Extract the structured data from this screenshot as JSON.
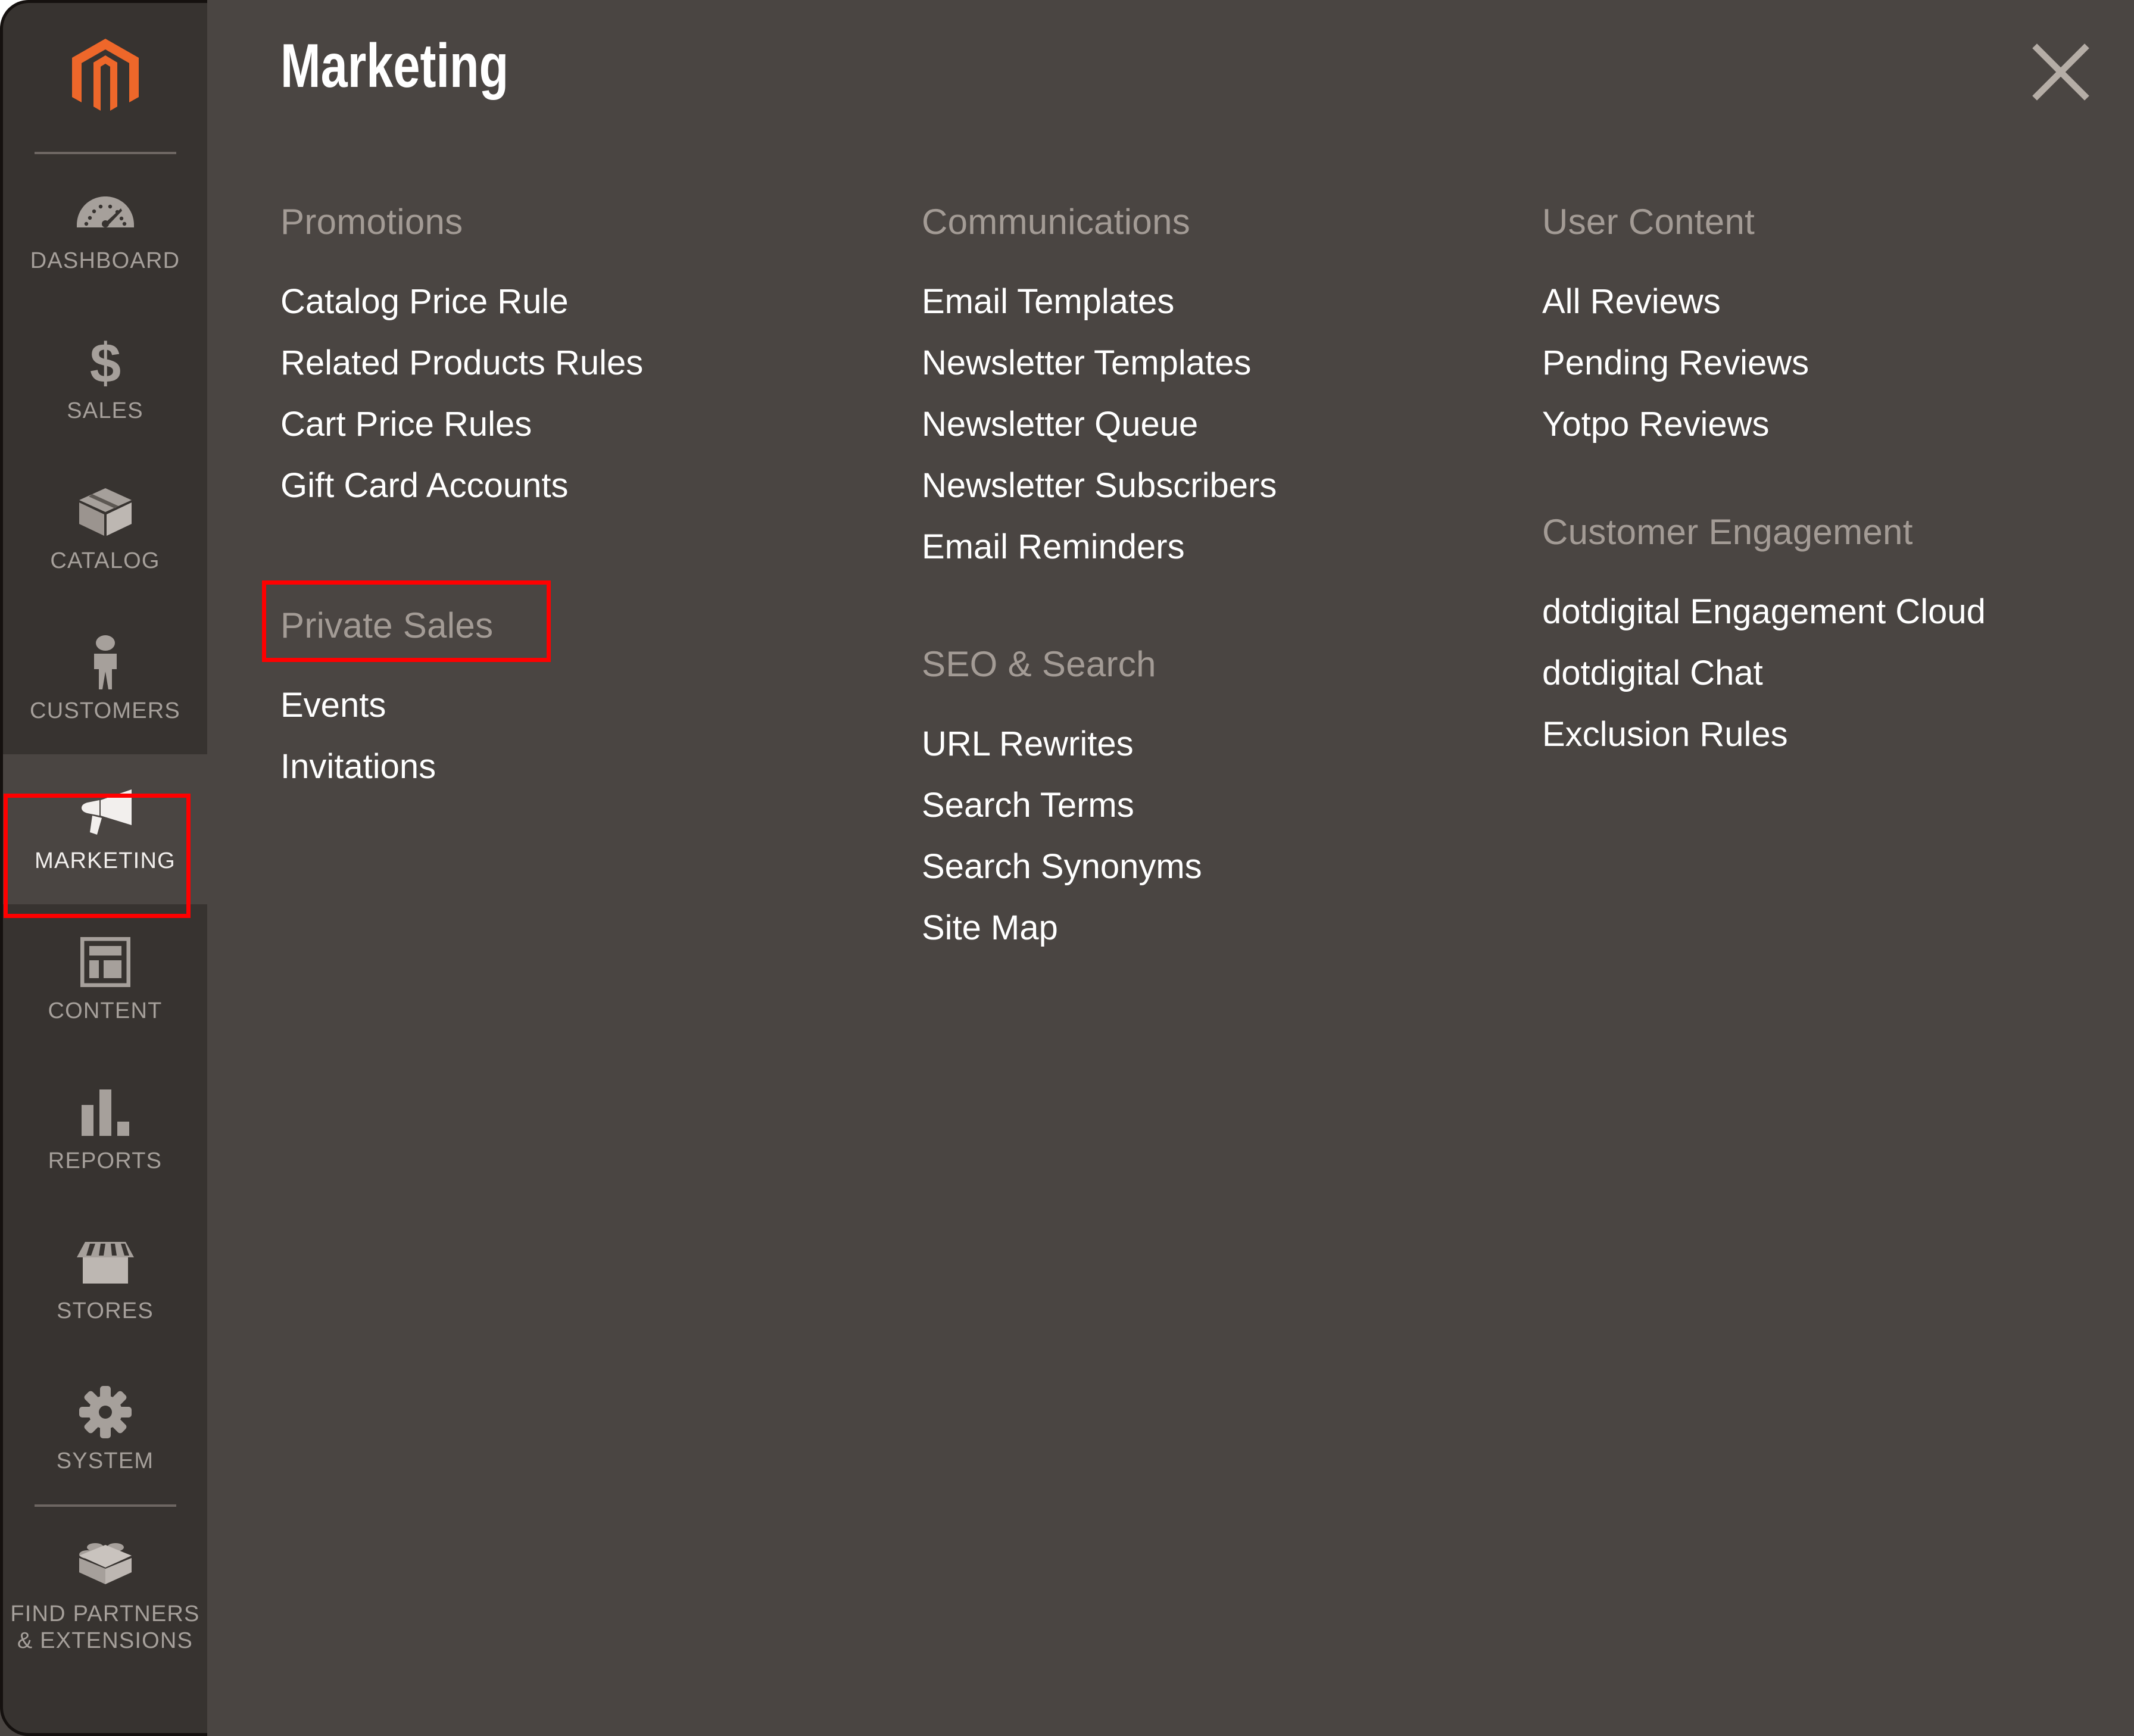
{
  "header": {
    "title": "Marketing",
    "close_label": "✕"
  },
  "sidebar": {
    "logo_name": "magento-logo",
    "items": [
      {
        "label": "DASHBOARD",
        "icon": "dashboard-gauge-icon",
        "active": false
      },
      {
        "label": "SALES",
        "icon": "dollar-sign-icon",
        "active": false
      },
      {
        "label": "CATALOG",
        "icon": "box-icon",
        "active": false
      },
      {
        "label": "CUSTOMERS",
        "icon": "person-icon",
        "active": false
      },
      {
        "label": "MARKETING",
        "icon": "megaphone-icon",
        "active": true
      },
      {
        "label": "CONTENT",
        "icon": "page-layout-icon",
        "active": false
      },
      {
        "label": "REPORTS",
        "icon": "bar-chart-icon",
        "active": false
      },
      {
        "label": "STORES",
        "icon": "storefront-icon",
        "active": false
      },
      {
        "label": "SYSTEM",
        "icon": "gear-icon",
        "active": false
      },
      {
        "label": "FIND PARTNERS\n& EXTENSIONS",
        "icon": "lego-brick-icon",
        "active": false
      }
    ],
    "item_labels": {
      "dashboard": "DASHBOARD",
      "sales": "SALES",
      "catalog": "CATALOG",
      "customers": "CUSTOMERS",
      "marketing": "MARKETING",
      "content": "CONTENT",
      "reports": "REPORTS",
      "stores": "STORES",
      "system": "SYSTEM",
      "find_partners_line1": "FIND PARTNERS",
      "find_partners_line2": "& EXTENSIONS"
    }
  },
  "menu": {
    "columns": [
      {
        "groups": [
          {
            "title": "Promotions",
            "items": [
              "Catalog Price Rule",
              "Related Products Rules",
              "Cart Price Rules",
              "Gift Card Accounts"
            ]
          },
          {
            "title": "Private Sales",
            "items": [
              "Events",
              "Invitations"
            ]
          }
        ]
      },
      {
        "groups": [
          {
            "title": "Communications",
            "items": [
              "Email Templates",
              "Newsletter Templates",
              "Newsletter Queue",
              "Newsletter Subscribers",
              "Email Reminders"
            ]
          },
          {
            "title": "SEO & Search",
            "items": [
              "URL Rewrites",
              "Search Terms",
              "Search Synonyms",
              "Site Map"
            ]
          }
        ]
      },
      {
        "groups": [
          {
            "title": "User Content",
            "items": [
              "All Reviews",
              "Pending Reviews",
              "Yotpo Reviews"
            ]
          },
          {
            "title": "Customer Engagement",
            "items": [
              "dotdigital Engagement Cloud",
              "dotdigital Chat",
              "Exclusion Rules"
            ]
          }
        ]
      }
    ]
  },
  "annotations": {
    "highlight_color": "#ff0000",
    "highlighted_sidebar_item": "MARKETING",
    "highlighted_menu_item": "Cart Price Rules"
  },
  "colors": {
    "sidebar_bg": "#373330",
    "panel_bg": "#4a4542",
    "brand_orange": "#ee672a",
    "link_text": "#ffffff",
    "group_title_text": "#a39b95",
    "sidebar_label_text": "#a6a09b"
  }
}
